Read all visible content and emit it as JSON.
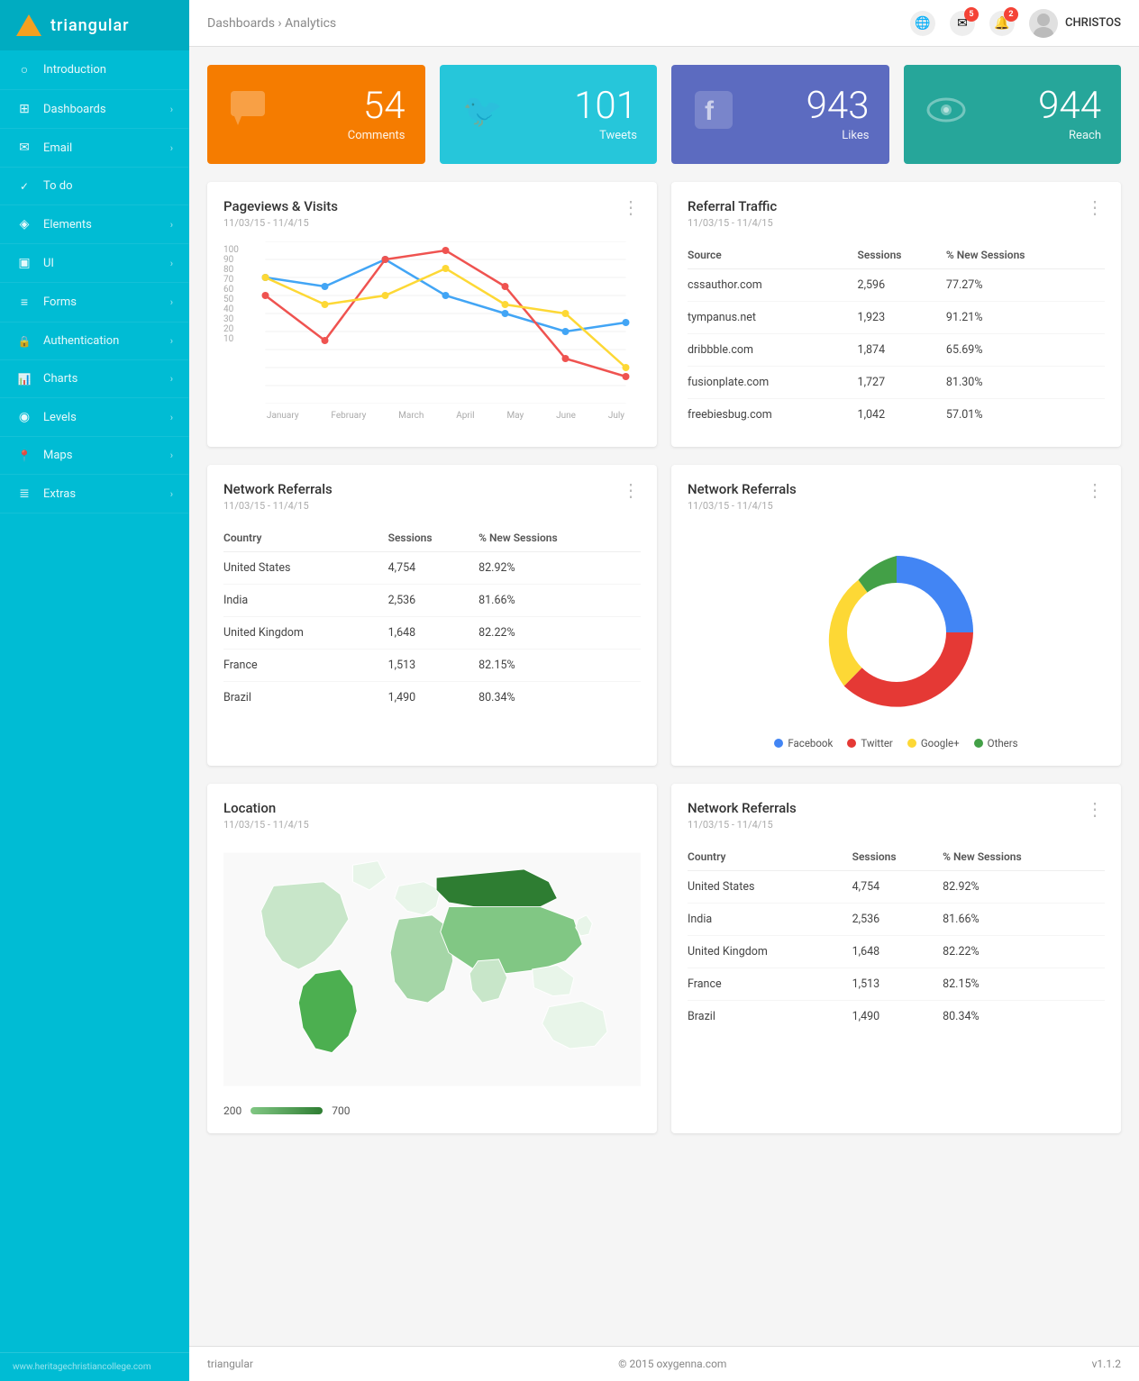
{
  "app": {
    "logo_text": "triangular",
    "footer_url": "www.heritagechristiancollege.com",
    "footer_copy": "© 2015 oxygenna.com",
    "footer_version": "v1.1.2"
  },
  "sidebar": {
    "items": [
      {
        "id": "introduction",
        "label": "Introduction",
        "icon": "○",
        "hasArrow": false,
        "active": false
      },
      {
        "id": "dashboards",
        "label": "Dashboards",
        "icon": "⊞",
        "hasArrow": true,
        "active": false
      },
      {
        "id": "email",
        "label": "Email",
        "icon": "✉",
        "hasArrow": true,
        "active": false
      },
      {
        "id": "todo",
        "label": "To do",
        "icon": "✓",
        "hasArrow": false,
        "active": false
      },
      {
        "id": "elements",
        "label": "Elements",
        "icon": "◈",
        "hasArrow": true,
        "active": false
      },
      {
        "id": "ui",
        "label": "UI",
        "icon": "▣",
        "hasArrow": true,
        "active": false
      },
      {
        "id": "forms",
        "label": "Forms",
        "icon": "≡",
        "hasArrow": true,
        "active": false
      },
      {
        "id": "authentication",
        "label": "Authentication",
        "icon": "🔒",
        "hasArrow": true,
        "active": false
      },
      {
        "id": "charts",
        "label": "Charts",
        "icon": "📊",
        "hasArrow": true,
        "active": false
      },
      {
        "id": "levels",
        "label": "Levels",
        "icon": "◉",
        "hasArrow": true,
        "active": false
      },
      {
        "id": "maps",
        "label": "Maps",
        "icon": "📍",
        "hasArrow": true,
        "active": false
      },
      {
        "id": "extras",
        "label": "Extras",
        "icon": "≣",
        "hasArrow": true,
        "active": false
      }
    ]
  },
  "topbar": {
    "breadcrumb_root": "Dashboards",
    "breadcrumb_sep": " › ",
    "breadcrumb_current": "Analytics",
    "user_name": "CHRISTOS",
    "mail_badge": "5",
    "notif_badge": "2"
  },
  "stats": [
    {
      "id": "comments",
      "value": "54",
      "label": "Comments",
      "color": "#f57c00",
      "icon": "💬"
    },
    {
      "id": "tweets",
      "value": "101",
      "label": "Tweets",
      "color": "#26c6da",
      "icon": "🐦"
    },
    {
      "id": "likes",
      "value": "943",
      "label": "Likes",
      "color": "#5c6bc0",
      "icon": "f"
    },
    {
      "id": "reach",
      "value": "944",
      "label": "Reach",
      "color": "#26a69a",
      "icon": "👁"
    }
  ],
  "pageviews_card": {
    "title": "Pageviews & Visits",
    "subtitle": "11/03/15 - 11/4/15",
    "x_labels": [
      "January",
      "February",
      "March",
      "April",
      "May",
      "June",
      "July"
    ],
    "y_labels": [
      "100",
      "90",
      "80",
      "70",
      "60",
      "50",
      "40",
      "30",
      "20",
      "10"
    ]
  },
  "referral_card": {
    "title": "Referral Traffic",
    "subtitle": "11/03/15 - 11/4/15",
    "columns": [
      "Source",
      "Sessions",
      "% New Sessions"
    ],
    "rows": [
      [
        "cssauthor.com",
        "2,596",
        "77.27%"
      ],
      [
        "tympanus.net",
        "1,923",
        "91.21%"
      ],
      [
        "dribbble.com",
        "1,874",
        "65.69%"
      ],
      [
        "fusionplate.com",
        "1,727",
        "81.30%"
      ],
      [
        "freebiesbug.com",
        "1,042",
        "57.01%"
      ]
    ]
  },
  "network_referrals_left": {
    "title": "Network Referrals",
    "subtitle": "11/03/15 - 11/4/15",
    "columns": [
      "Country",
      "Sessions",
      "% New Sessions"
    ],
    "rows": [
      [
        "United States",
        "4,754",
        "82.92%"
      ],
      [
        "India",
        "2,536",
        "81.66%"
      ],
      [
        "United Kingdom",
        "1,648",
        "82.22%"
      ],
      [
        "France",
        "1,513",
        "82.15%"
      ],
      [
        "Brazil",
        "1,490",
        "80.34%"
      ]
    ]
  },
  "network_referrals_right": {
    "title": "Network Referrals",
    "subtitle": "11/03/15 - 11/4/15",
    "donut": {
      "segments": [
        {
          "label": "Facebook",
          "value": 35,
          "color": "#4285f4"
        },
        {
          "label": "Twitter",
          "value": 40,
          "color": "#e53935"
        },
        {
          "label": "Google+",
          "value": 15,
          "color": "#fdd835"
        },
        {
          "label": "Others",
          "value": 10,
          "color": "#43a047"
        }
      ]
    }
  },
  "location_card": {
    "title": "Location",
    "subtitle": "11/03/15 - 11/4/15",
    "legend_min": "200",
    "legend_max": "700"
  },
  "network_referrals_bottom": {
    "title": "Network Referrals",
    "subtitle": "11/03/15 - 11/4/15",
    "columns": [
      "Country",
      "Sessions",
      "% New Sessions"
    ],
    "rows": [
      [
        "United States",
        "4,754",
        "82.92%"
      ],
      [
        "India",
        "2,536",
        "81.66%"
      ],
      [
        "United Kingdom",
        "1,648",
        "82.22%"
      ],
      [
        "France",
        "1,513",
        "82.15%"
      ],
      [
        "Brazil",
        "1,490",
        "80.34%"
      ]
    ]
  }
}
